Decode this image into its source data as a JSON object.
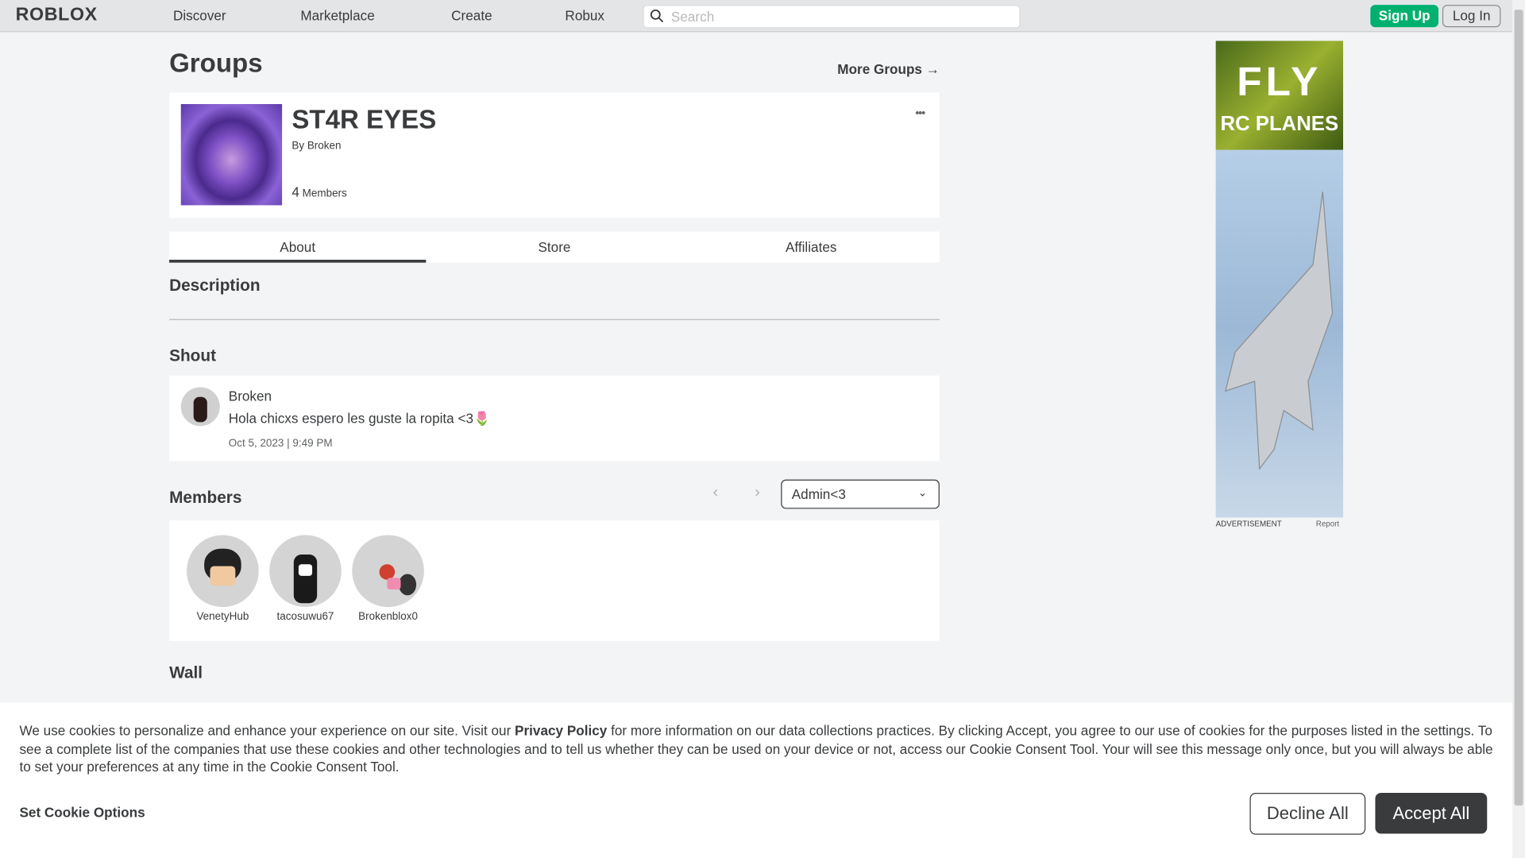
{
  "header": {
    "logo": "ROBLOX",
    "nav": [
      "Discover",
      "Marketplace",
      "Create",
      "Robux"
    ],
    "search_placeholder": "Search",
    "signup": "Sign Up",
    "login": "Log In"
  },
  "page": {
    "title": "Groups",
    "more_groups": "More Groups →"
  },
  "group": {
    "name": "ST4R EYES",
    "by_label": "By",
    "owner": "Broken",
    "member_count": "4",
    "members_label": "Members",
    "menu": "•••"
  },
  "tabs": [
    {
      "label": "About",
      "active": true
    },
    {
      "label": "Store"
    },
    {
      "label": "Affiliates"
    }
  ],
  "description": {
    "heading": "Description"
  },
  "shout": {
    "heading": "Shout",
    "author": "Broken",
    "text": "Hola chicxs espero les guste la ropita <3🌷",
    "timestamp": "Oct 5, 2023 | 9:49 PM"
  },
  "members": {
    "heading": "Members",
    "role_selected": "Admin<3",
    "list": [
      {
        "name": "VenetyHub"
      },
      {
        "name": "tacosuwu67"
      },
      {
        "name": "Brokenblox0"
      }
    ]
  },
  "wall": {
    "heading": "Wall"
  },
  "ad": {
    "line1": "FLY",
    "line2": "RC PLANES",
    "label": "ADVERTISEMENT",
    "report": "Report"
  },
  "cookie": {
    "text_before": "We use cookies to personalize and enhance your experience on our site. Visit our ",
    "privacy_link": "Privacy Policy",
    "text_after": " for more information on our data collections practices. By clicking Accept, you agree to our use of cookies for the purposes listed in the settings. To see a complete list of the companies that use these cookies and other technologies and to tell us whether they can be used on your device or not, access our Cookie Consent Tool. Your will see this message only once, but you will always be able to set your preferences at any time in the Cookie Consent Tool.",
    "set_options": "Set Cookie Options",
    "decline": "Decline All",
    "accept": "Accept All"
  }
}
